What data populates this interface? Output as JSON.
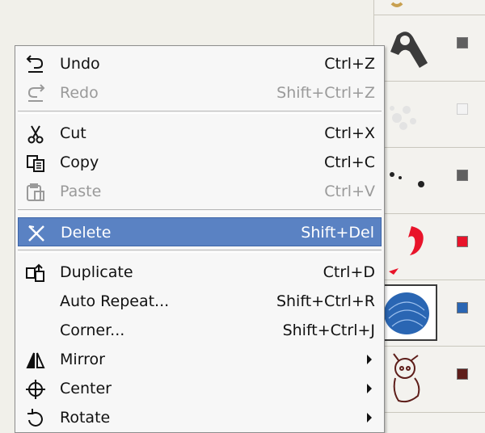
{
  "menu": {
    "items": [
      {
        "label": "Undo",
        "shortcut": "Ctrl+Z",
        "icon": "undo-icon",
        "enabled": true
      },
      {
        "label": "Redo",
        "shortcut": "Shift+Ctrl+Z",
        "icon": "redo-icon",
        "enabled": false
      },
      {
        "label": "Cut",
        "shortcut": "Ctrl+X",
        "icon": "scissors-icon",
        "enabled": true
      },
      {
        "label": "Copy",
        "shortcut": "Ctrl+C",
        "icon": "copy-icon",
        "enabled": true
      },
      {
        "label": "Paste",
        "shortcut": "Ctrl+V",
        "icon": "paste-icon",
        "enabled": false
      },
      {
        "label": "Delete",
        "shortcut": "Shift+Del",
        "icon": "delete-x-icon",
        "enabled": true,
        "highlighted": true
      },
      {
        "label": "Duplicate",
        "shortcut": "Ctrl+D",
        "icon": "duplicate-icon",
        "enabled": true
      },
      {
        "label": "Auto Repeat...",
        "shortcut": "Shift+Ctrl+R",
        "icon": "",
        "enabled": true
      },
      {
        "label": "Corner...",
        "shortcut": "Shift+Ctrl+J",
        "icon": "",
        "enabled": true
      },
      {
        "label": "Mirror",
        "shortcut": "",
        "icon": "mirror-icon",
        "enabled": true,
        "submenu": true
      },
      {
        "label": "Center",
        "shortcut": "",
        "icon": "center-crosshair-icon",
        "enabled": true,
        "submenu": true
      },
      {
        "label": "Rotate",
        "shortcut": "",
        "icon": "rotate-icon",
        "enabled": true,
        "submenu": true
      }
    ]
  },
  "object_list": {
    "rows": [
      {
        "name": "object-row",
        "color": "#606060"
      },
      {
        "name": "object-row",
        "color": "#f3f3f3"
      },
      {
        "name": "object-row",
        "color": "#606060"
      },
      {
        "name": "object-row",
        "color": "#e8142a"
      },
      {
        "name": "object-row",
        "color": "#2a66b3",
        "selected": true
      },
      {
        "name": "object-row",
        "color": "#5e1e1a"
      }
    ]
  },
  "colors": {
    "highlight": "#5a82c3",
    "menu_bg": "#f7f7f7",
    "disabled_text": "#9a9a9a"
  }
}
